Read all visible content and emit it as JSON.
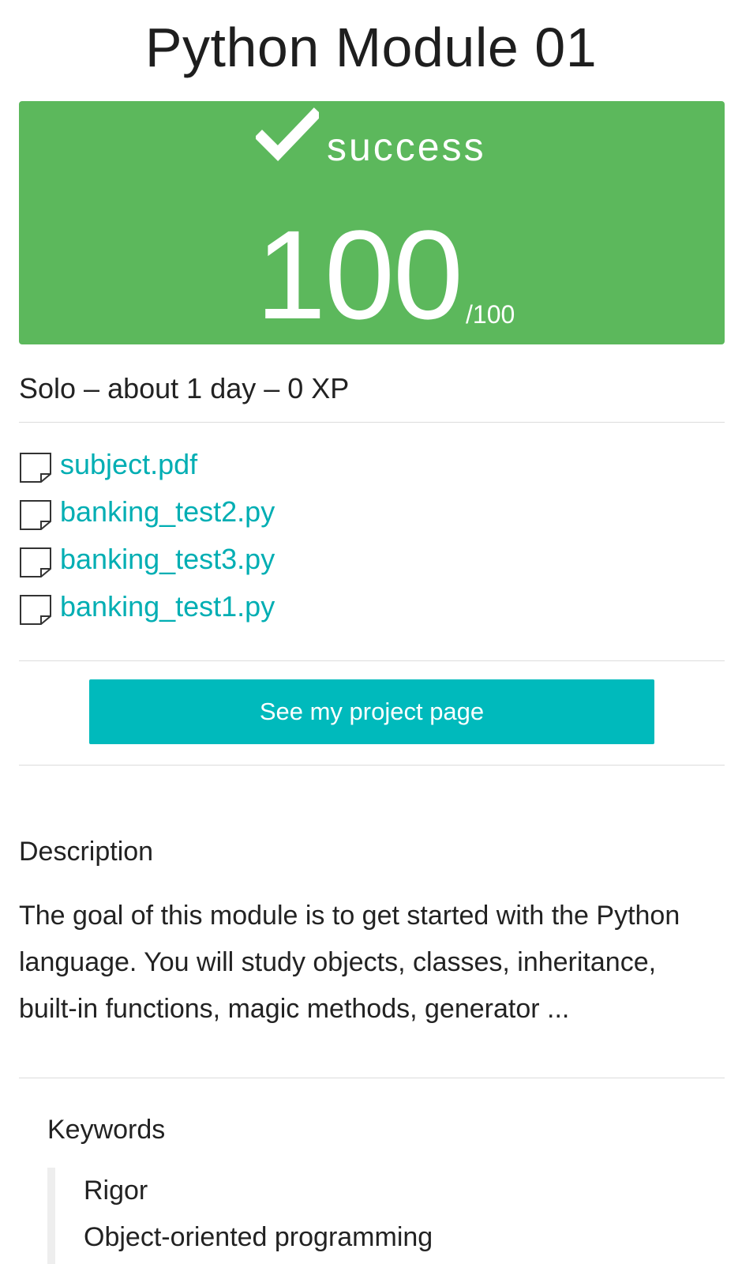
{
  "page": {
    "title": "Python Module 01"
  },
  "result": {
    "status_icon": "check-icon",
    "status": "success",
    "score": "100",
    "max_score": "/100",
    "color": "#5cb85c"
  },
  "meta": {
    "text": "Solo – about 1 day – 0 XP"
  },
  "attachments": [
    {
      "icon": "file-icon",
      "name": "subject.pdf"
    },
    {
      "icon": "file-icon",
      "name": "banking_test2.py"
    },
    {
      "icon": "file-icon",
      "name": "banking_test3.py"
    },
    {
      "icon": "file-icon",
      "name": "banking_test1.py"
    }
  ],
  "actions": {
    "project_page_label": "See my project page",
    "accent": "#00babc"
  },
  "description": {
    "heading": "Description",
    "text": "The goal of this module is to get started with the Python language. You will study objects, classes, inheritance, built-in functions, magic methods, generator ..."
  },
  "keywords": {
    "heading": "Keywords",
    "items": [
      "Rigor",
      "Object-oriented programming"
    ]
  }
}
